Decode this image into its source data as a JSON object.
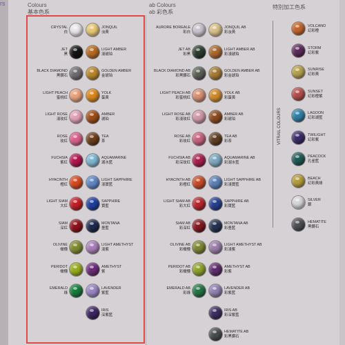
{
  "headers": {
    "solid_top": "Colours",
    "solid_sub": "基本色系",
    "ab_top": "ab Colours",
    "ab_sub": "ab 彩色系",
    "special": "特別加工色系",
    "vitrail": "VITRAIL COLOURS",
    "corner": "rs"
  },
  "solid": [
    {
      "en": "CRYSTAL",
      "zh": "白",
      "color": "#e8e6ea"
    },
    {
      "en": "JONQUIL",
      "zh": "淡黃",
      "color": "#e9c874"
    },
    {
      "en": "JET",
      "zh": "黑",
      "color": "#141414"
    },
    {
      "en": "LIGHT AMBER",
      "zh": "淺琥珀",
      "color": "#b56a20"
    },
    {
      "en": "BLACK DIAMOND",
      "zh": "黑鑽石",
      "color": "#6e6c70"
    },
    {
      "en": "GOLDEN AMBER",
      "zh": "金琥珀",
      "color": "#b9872b"
    },
    {
      "en": "LIGHT PEACH",
      "zh": "蜜桃紅",
      "color": "#e9a07a"
    },
    {
      "en": "YOLK",
      "zh": "蛋黃",
      "color": "#d9861a"
    },
    {
      "en": "LIGHT ROSE",
      "zh": "淺玫紅",
      "color": "#e3a1b6"
    },
    {
      "en": "AMBER",
      "zh": "琥珀",
      "color": "#9e4c15"
    },
    {
      "en": "ROSE",
      "zh": "玫紅",
      "color": "#d9608a"
    },
    {
      "en": "TEA",
      "zh": "茶",
      "color": "#6b3e1a"
    },
    {
      "en": "FUCHSIA",
      "zh": "紫紅",
      "color": "#b2144e"
    },
    {
      "en": "AQUAMARINE",
      "zh": "湖水藍",
      "color": "#7fb6d3"
    },
    {
      "en": "HYACINTH",
      "zh": "橙紅",
      "color": "#d6481e"
    },
    {
      "en": "LIGHT SAPPHIRE",
      "zh": "淺寶藍",
      "color": "#5f87c4"
    },
    {
      "en": "LIGHT SIAM",
      "zh": "大紅",
      "color": "#c11e26"
    },
    {
      "en": "SAPPHIRE",
      "zh": "寶藍",
      "color": "#1f3f9e"
    },
    {
      "en": "SIAM",
      "zh": "深紅",
      "color": "#8d1219"
    },
    {
      "en": "MONTANA",
      "zh": "墨藍",
      "color": "#1d2a4d"
    },
    {
      "en": "OLIVINE",
      "zh": "橄欖",
      "color": "#7e8a2e"
    },
    {
      "en": "LIGHT AMETHYST",
      "zh": "淺紫",
      "color": "#a97fb8"
    },
    {
      "en": "PERIDOT",
      "zh": "橄欖",
      "color": "#97ad1e"
    },
    {
      "en": "AMETHYST",
      "zh": "紫",
      "color": "#6a2a78"
    },
    {
      "en": "EMERALD",
      "zh": "綠",
      "color": "#167a3b"
    },
    {
      "en": "LAVENDER",
      "zh": "紫藍",
      "color": "#9a85c2"
    },
    {
      "en": "",
      "zh": "",
      "color": ""
    },
    {
      "en": "IRIS",
      "zh": "深紫藍",
      "color": "#3b2660"
    }
  ],
  "ab": [
    {
      "en": "AURORE BOREALE",
      "zh": "彩白",
      "color": "#c9c2cf"
    },
    {
      "en": "JONQUIL AB",
      "zh": "彩淡黃",
      "color": "#d8c08a"
    },
    {
      "en": "JET AB",
      "zh": "彩黑",
      "color": "#2b3b2e"
    },
    {
      "en": "LIGHT AMBER AB",
      "zh": "彩淺琥珀",
      "color": "#a8672c"
    },
    {
      "en": "BLACK DIAMOND AB",
      "zh": "彩黑鑽石",
      "color": "#5a5f55"
    },
    {
      "en": "GOLDEN AMBER AB",
      "zh": "彩金琥珀",
      "color": "#a57a35"
    },
    {
      "en": "LIGHT PEACH AB",
      "zh": "彩蜜桃紅",
      "color": "#d69072"
    },
    {
      "en": "YOLK AB",
      "zh": "彩蛋黃",
      "color": "#cf8a2c"
    },
    {
      "en": "LIGHT ROSE AB",
      "zh": "彩淺玫紅",
      "color": "#cf98a8"
    },
    {
      "en": "AMBER AB",
      "zh": "彩琥珀",
      "color": "#8c4b1f"
    },
    {
      "en": "ROSE AB",
      "zh": "彩玫紅",
      "color": "#c8607d"
    },
    {
      "en": "TEA AB",
      "zh": "彩茶",
      "color": "#5f3e22"
    },
    {
      "en": "FUCHSIA AB",
      "zh": "彩深玫紅",
      "color": "#a61f4c"
    },
    {
      "en": "AQUAMARINE AB",
      "zh": "彩湖水藍",
      "color": "#7ba8bf"
    },
    {
      "en": "HYACINTH AB",
      "zh": "彩橙紅",
      "color": "#c54a27"
    },
    {
      "en": "LIGHT SAPPHIRE AB",
      "zh": "彩淺寶藍",
      "color": "#5b80b6"
    },
    {
      "en": "LIGHT SIAM AB",
      "zh": "彩大紅",
      "color": "#b5262c"
    },
    {
      "en": "SAPPHIRE AB",
      "zh": "彩寶藍",
      "color": "#27408f"
    },
    {
      "en": "SIAM AB",
      "zh": "彩深紅",
      "color": "#821820"
    },
    {
      "en": "MONTANA AB",
      "zh": "彩墨藍",
      "color": "#263350"
    },
    {
      "en": "OLIVINE AB",
      "zh": "彩橄欖",
      "color": "#7c8533"
    },
    {
      "en": "LIGHT AMETHYST AB",
      "zh": "彩淺紫",
      "color": "#9c7eaa"
    },
    {
      "en": "PERIDOT AB",
      "zh": "彩橄欖",
      "color": "#8da12a"
    },
    {
      "en": "AMETHYST AB",
      "zh": "彩紫",
      "color": "#5f2d6c"
    },
    {
      "en": "EMERALD AB",
      "zh": "彩綠",
      "color": "#237344"
    },
    {
      "en": "LAVENDER AB",
      "zh": "彩紫藍",
      "color": "#8e80b0"
    },
    {
      "en": "",
      "zh": "",
      "color": ""
    },
    {
      "en": "IRIS AB",
      "zh": "彩深紫藍",
      "color": "#3c2d5e"
    },
    {
      "en": "",
      "zh": "",
      "color": ""
    },
    {
      "en": "HEMATITE AB",
      "zh": "彩黑鑽石",
      "color": "#4a4d4e"
    }
  ],
  "special_items": [
    {
      "en": "VOLCANO",
      "zh": "幻彩橙",
      "color": "#c2642a"
    },
    {
      "en": "STORM",
      "zh": "幻彩紫",
      "color": "#5b2a5b"
    },
    {
      "en": "SUNRISE",
      "zh": "幻彩黃",
      "color": "#b5a04a"
    },
    {
      "en": "SUNSET",
      "zh": "幻彩橙紫",
      "color": "#b34e4a"
    },
    {
      "en": "LAGOON",
      "zh": "幻彩湖藍",
      "color": "#2f7fa6"
    },
    {
      "en": "TWILIGHT",
      "zh": "幻彩紫",
      "color": "#3a2c6a"
    },
    {
      "en": "PEACOCK",
      "zh": "孔雀藍",
      "color": "#1f5a57"
    },
    {
      "en": "BEACH",
      "zh": "幻彩黃綠",
      "color": "#b39c3a"
    },
    {
      "en": "SILVER",
      "zh": "銀",
      "color": "#d6d6da"
    },
    {
      "en": "HEMATITE",
      "zh": "黑鑽石",
      "color": "#4c4f53"
    }
  ]
}
